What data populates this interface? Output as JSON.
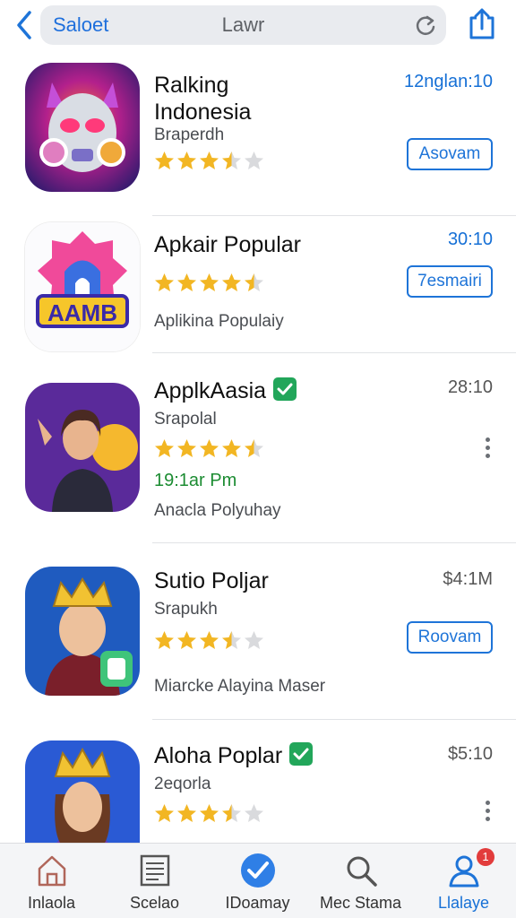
{
  "topbar": {
    "search_left": "Saloet",
    "search_center": "Lawr"
  },
  "apps": [
    {
      "name_line1": "Ralking",
      "name_line2": "Indonesia",
      "subtitle": "Braperdh",
      "time": "12nglan:10",
      "rating": 3.5,
      "action": "Asovam"
    },
    {
      "name": "Apkair Popular",
      "time": "30:10",
      "rating": 4.5,
      "action": "7esmairi",
      "description": "Aplikina Populaiy",
      "icon_text": "AAMB"
    },
    {
      "name": "ApplkAasia",
      "subtitle": "Srapolal",
      "time": "28:10",
      "rating": 4.5,
      "green_text": "19:1ar Pm",
      "description": "Anacla Polyuhay"
    },
    {
      "name": "Sutio Poljar",
      "subtitle": "Srapukh",
      "time": "$4:1M",
      "rating": 3.5,
      "action": "Roovam",
      "description": "Miarcke Alayina Maser"
    },
    {
      "name": "Aloha Poplar",
      "subtitle": "2eqorla",
      "time": "$5:10",
      "rating": 3.5
    }
  ],
  "tabbar": {
    "tabs": [
      {
        "label": "Inlaola",
        "icon": "home-icon"
      },
      {
        "label": "Scelao",
        "icon": "list-icon"
      },
      {
        "label": "IDoamay",
        "icon": "check-circle-icon"
      },
      {
        "label": "Mec Stama",
        "icon": "search-icon"
      },
      {
        "label": "Llalaye",
        "icon": "person-icon",
        "badge": "1"
      }
    ]
  },
  "colors": {
    "accent": "#1670d6",
    "star": "#f2b623",
    "verified": "#22a65a",
    "badge": "#e23c3c"
  }
}
